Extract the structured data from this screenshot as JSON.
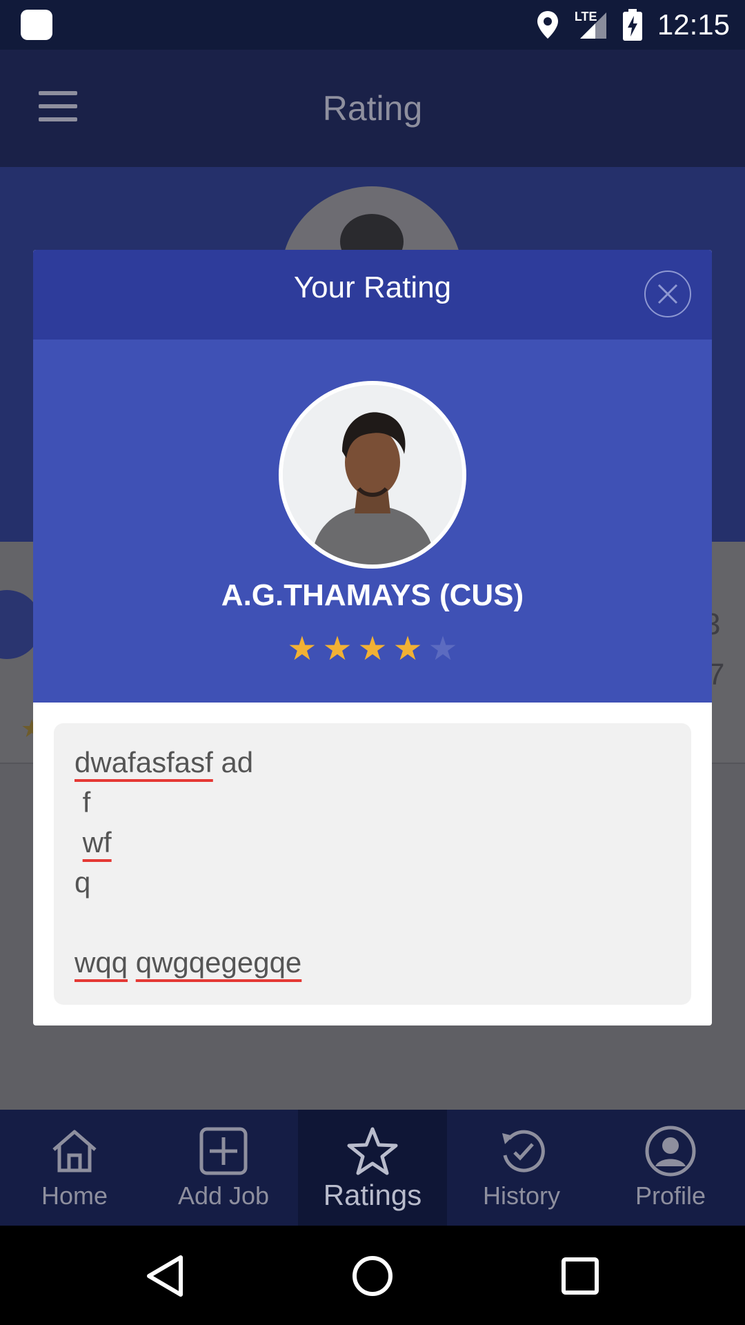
{
  "status_bar": {
    "time": "12:15",
    "network": "LTE",
    "icons": [
      "app-icon",
      "location-icon",
      "signal-icon",
      "battery-charging-icon"
    ]
  },
  "app_bar": {
    "title": "Rating",
    "menu_icon": "menu-icon"
  },
  "background": {
    "partial_values": [
      "3",
      "7"
    ]
  },
  "modal": {
    "title": "Your Rating",
    "close_icon": "close-icon",
    "user_name": "A.G.THAMAYS (CUS)",
    "rating": {
      "value": 4,
      "max": 5,
      "filled_color": "#f2b134",
      "empty_color": "#5c6bc0"
    },
    "review_lines": [
      "dwafasfasf ad",
      " f",
      " wf",
      "q",
      "",
      "wqq qwgqegegqe"
    ]
  },
  "bottom_nav": {
    "items": [
      {
        "label": "Home",
        "icon": "home-icon"
      },
      {
        "label": "Add Job",
        "icon": "add-box-icon"
      },
      {
        "label": "Ratings",
        "icon": "star-outline-icon",
        "active": true
      },
      {
        "label": "History",
        "icon": "history-icon"
      },
      {
        "label": "Profile",
        "icon": "profile-icon"
      }
    ]
  },
  "colors": {
    "primary": "#3f51b5",
    "primary_dark": "#2e3c9b",
    "nav_bg": "#151d45",
    "star": "#f2b134"
  }
}
